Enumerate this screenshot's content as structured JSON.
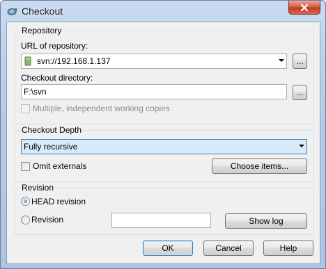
{
  "window": {
    "title": "Checkout",
    "close_icon": "close-icon"
  },
  "repository": {
    "group_label": "Repository",
    "url_label": "URL of repository:",
    "url_value": "svn://192.168.1.137",
    "browse_label": "...",
    "dir_label": "Checkout directory:",
    "dir_value": "F:\\svn",
    "browse_dir_label": "...",
    "multiple_label": "Multiple, independent working copies",
    "multiple_checked": false,
    "multiple_enabled": false
  },
  "depth": {
    "group_label": "Checkout Depth",
    "selected": "Fully recursive",
    "omit_label": "Omit externals",
    "omit_checked": false,
    "choose_label": "Choose items..."
  },
  "revision": {
    "group_label": "Revision",
    "head_label": "HEAD revision",
    "head_selected": true,
    "revision_label": "Revision",
    "revision_value": "",
    "showlog_label": "Show log"
  },
  "footer": {
    "ok_label": "OK",
    "cancel_label": "Cancel",
    "help_label": "Help"
  },
  "colors": {
    "accent": "#3c7fb1",
    "selection": "#d7ebfb"
  }
}
